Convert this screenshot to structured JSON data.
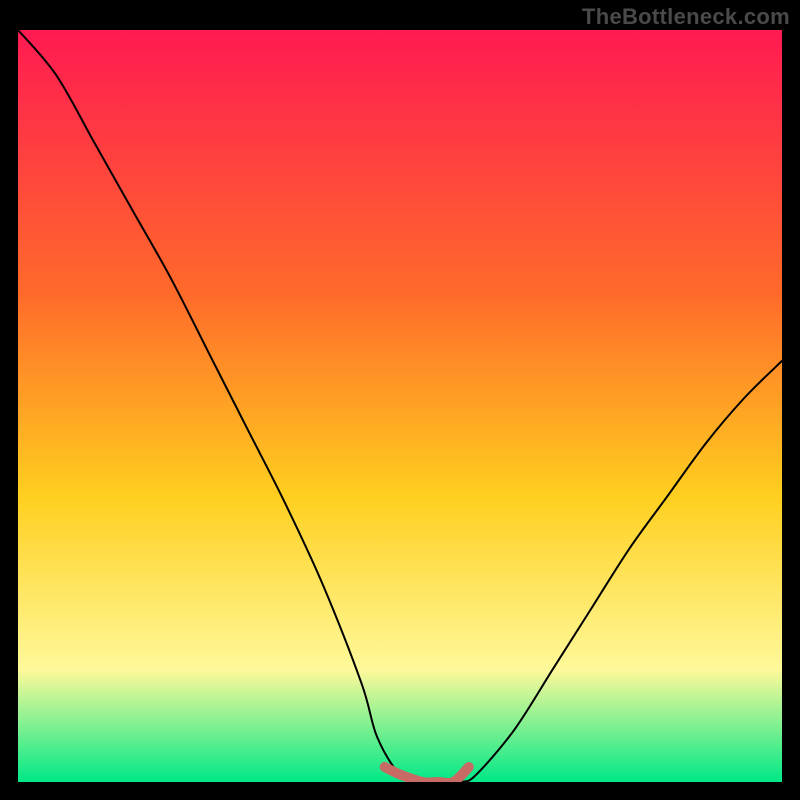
{
  "watermark": "TheBottleneck.com",
  "colors": {
    "frame_bg": "#000000",
    "gradient_top": "#ff1a52",
    "gradient_mid1": "#ff6a2a",
    "gradient_mid2": "#ffcf1f",
    "gradient_low": "#fff99a",
    "gradient_bottom": "#00e887",
    "curve": "#000000",
    "highlight": "#c86b65"
  },
  "chart_data": {
    "type": "line",
    "title": "",
    "xlabel": "",
    "ylabel": "",
    "xlim": [
      0,
      100
    ],
    "ylim": [
      0,
      100
    ],
    "series": [
      {
        "name": "bottleneck-curve",
        "x": [
          0,
          5,
          10,
          15,
          20,
          25,
          30,
          35,
          40,
          45,
          47,
          50,
          53,
          55,
          58,
          60,
          65,
          70,
          75,
          80,
          85,
          90,
          95,
          100
        ],
        "y": [
          100,
          94,
          85,
          76,
          67,
          57,
          47,
          37,
          26,
          13,
          6,
          1,
          0,
          0,
          0,
          1,
          7,
          15,
          23,
          31,
          38,
          45,
          51,
          56
        ]
      },
      {
        "name": "valley-highlight",
        "x": [
          48,
          50,
          53,
          55,
          57,
          59
        ],
        "y": [
          2,
          1,
          0,
          0,
          0,
          2
        ]
      }
    ],
    "annotations": []
  }
}
